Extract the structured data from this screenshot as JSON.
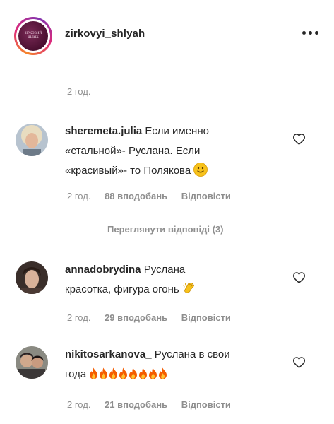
{
  "post": {
    "username": "zirkovyi_shlyah",
    "avatar_text": "ЗІРКОВИЙ ШЛЯХ",
    "more_icon": "ellipsis-icon",
    "caption_time": "2 год."
  },
  "comments": [
    {
      "username": "sheremeta.julia",
      "text_line1": "Если именно",
      "text_line2": "«стальной»- Руслана. Если",
      "text_line3": "«красивый»- то Полякова",
      "emoji": "slightly-smiling-face",
      "time": "2 год.",
      "likes": "88 вподобань",
      "reply": "Відповісти",
      "view_replies": "Переглянути відповіді (3)"
    },
    {
      "username": "annadobrydina",
      "text_line1": "Руслана",
      "text_line2": "красотка, фигура огонь",
      "emoji": "clapping-hands",
      "time": "2 год.",
      "likes": "29 вподобань",
      "reply": "Відповісти"
    },
    {
      "username": "nikitosarkanova_",
      "text_line1": "Руслана в свои",
      "text_line2": "года",
      "emoji": "fire",
      "emoji_count": 8,
      "time": "2 год.",
      "likes": "21 вподобань",
      "reply": "Відповісти"
    }
  ],
  "colors": {
    "text": "#262626",
    "muted": "#8e8e8e",
    "divider": "#efefef",
    "ring_gradient": [
      "#f58529",
      "#dd2a7b",
      "#8134af"
    ]
  }
}
